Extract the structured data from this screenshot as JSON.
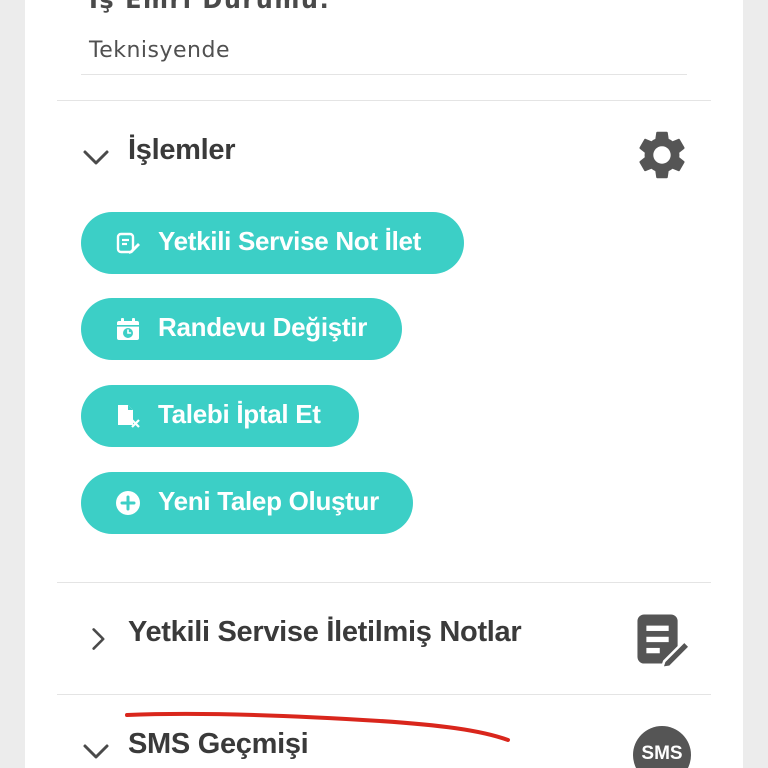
{
  "work_order": {
    "status_label": "İş Emri Durumu:",
    "status_value": "Teknisyende"
  },
  "operations": {
    "title": "İşlemler",
    "expanded": true,
    "icon": "gear-icon",
    "actions": [
      {
        "label": "Yetkili Servise Not İlet",
        "icon": "note-edit-icon"
      },
      {
        "label": "Randevu Değiştir",
        "icon": "calendar-clock-icon"
      },
      {
        "label": "Talebi İptal Et",
        "icon": "file-cancel-icon"
      },
      {
        "label": "Yeni Talep Oluştur",
        "icon": "plus-circle-icon"
      }
    ]
  },
  "notes_section": {
    "title": "Yetkili Servise İletilmiş Notlar",
    "expanded": false,
    "icon": "note-edit-icon"
  },
  "sms_section": {
    "title": "SMS Geçmişi",
    "expanded": true,
    "badge": "SMS"
  },
  "colors": {
    "accent": "#3ccfc6",
    "icon_gray": "#555555",
    "annotation_red": "#d9261c"
  }
}
